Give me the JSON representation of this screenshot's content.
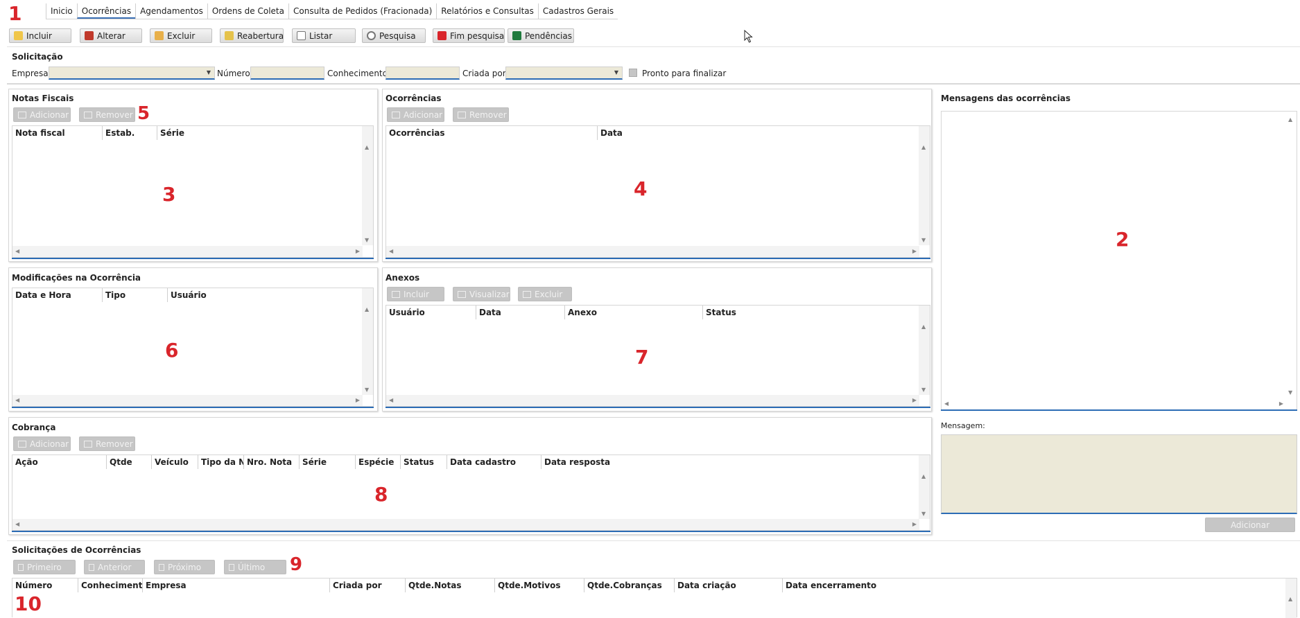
{
  "tabs": [
    "Inicio",
    "Ocorrências",
    "Agendamentos",
    "Ordens de Coleta",
    "Consulta de Pedidos (Fracionada)",
    "Relatórios e Consultas",
    "Cadastros Gerais"
  ],
  "toolbar": {
    "incluir": "Incluir",
    "alterar": "Alterar",
    "excluir": "Excluir",
    "reabertura": "Reabertura",
    "listar": "Listar",
    "pesquisa": "Pesquisa",
    "fim_pesquisa": "Fim pesquisa",
    "pendencias": "Pendências"
  },
  "solicitacao": {
    "title": "Solicitação",
    "empresa": "Empresa",
    "numero": "Número",
    "conhecimento": "Conhecimento",
    "criada_por": "Criada por",
    "pronto": "Pronto para finalizar"
  },
  "notas": {
    "title": "Notas Fiscais",
    "adicionar": "Adicionar",
    "remover": "Remover",
    "columns": [
      "Nota fiscal",
      "Estab.",
      "Série"
    ]
  },
  "ocorrencias": {
    "title": "Ocorrências",
    "adicionar": "Adicionar",
    "remover": "Remover",
    "columns": [
      "Ocorrências",
      "Data"
    ]
  },
  "mensagens": {
    "title": "Mensagens das ocorrências",
    "mensagem_label": "Mensagem:",
    "adicionar": "Adicionar"
  },
  "modificacoes": {
    "title": "Modificações na Ocorrência",
    "columns": [
      "Data e Hora",
      "Tipo",
      "Usuário"
    ]
  },
  "anexos": {
    "title": "Anexos",
    "incluir": "Incluir",
    "visualizar": "Visualizar",
    "excluir": "Excluir",
    "columns": [
      "Usuário",
      "Data",
      "Anexo",
      "Status"
    ]
  },
  "cobranca": {
    "title": "Cobrança",
    "adicionar": "Adicionar",
    "remover": "Remover",
    "columns": [
      "Ação",
      "Qtde",
      "Veículo",
      "Tipo da No",
      "Nro. Nota",
      "Série",
      "Espécie",
      "Status",
      "Data cadastro",
      "Data resposta"
    ]
  },
  "solicitacoes": {
    "title": "Solicitações de Ocorrências",
    "primeiro": "Primeiro",
    "anterior": "Anterior",
    "proximo": "Próximo",
    "ultimo": "Último",
    "columns": [
      "Número",
      "Conhecimento",
      "Empresa",
      "Criada por",
      "Qtde.Notas",
      "Qtde.Motivos",
      "Qtde.Cobranças",
      "Data criação",
      "Data encerramento"
    ]
  },
  "annotations": [
    "1",
    "2",
    "3",
    "4",
    "5",
    "6",
    "7",
    "8",
    "9",
    "10"
  ],
  "colors": {
    "accent": "#2c6cb5",
    "annotation": "#d9252b",
    "input_bg": "#ece9d8",
    "disabled_btn": "#c6c6c6"
  }
}
